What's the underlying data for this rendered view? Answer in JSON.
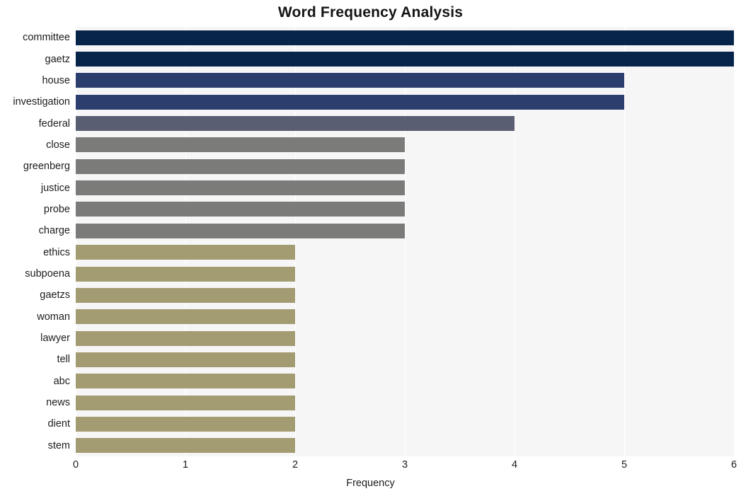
{
  "chart_data": {
    "type": "bar",
    "orientation": "horizontal",
    "title": "Word Frequency Analysis",
    "xlabel": "Frequency",
    "ylabel": "",
    "xlim": [
      0,
      6
    ],
    "xticks": [
      "0",
      "1",
      "2",
      "3",
      "4",
      "5",
      "6"
    ],
    "grid": true,
    "legend": "none",
    "categories": [
      "committee",
      "gaetz",
      "house",
      "investigation",
      "federal",
      "close",
      "greenberg",
      "justice",
      "probe",
      "charge",
      "ethics",
      "subpoena",
      "gaetzs",
      "woman",
      "lawyer",
      "tell",
      "abc",
      "news",
      "dient",
      "stem"
    ],
    "values": [
      6,
      6,
      5,
      5,
      4,
      3,
      3,
      3,
      3,
      3,
      2,
      2,
      2,
      2,
      2,
      2,
      2,
      2,
      2,
      2
    ],
    "bar_colors": [
      "#07244a",
      "#07244a",
      "#2c3e6e",
      "#2c3e6e",
      "#5a5e72",
      "#7b7c79",
      "#7b7c79",
      "#7b7c79",
      "#7b7c79",
      "#7b7c79",
      "#a39b72",
      "#a39b72",
      "#a39b72",
      "#a39b72",
      "#a39b72",
      "#a39b72",
      "#a39b72",
      "#a39b72",
      "#a39b72",
      "#a39b72"
    ]
  },
  "style": {
    "plot_background": "#f6f6f6",
    "figure_background": "#ffffff",
    "gridline_color": "#ffffff",
    "text_color": "#1c1c1c",
    "title_color": "#141414"
  }
}
